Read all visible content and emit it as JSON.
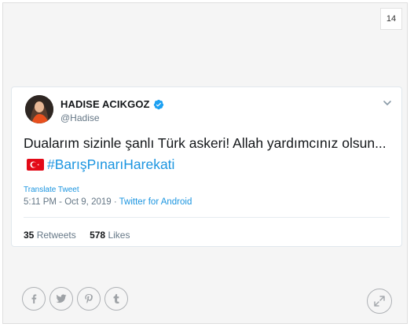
{
  "page_number": "14",
  "tweet": {
    "author_name": "HADISE ACIKGOZ",
    "handle": "@Hadise",
    "verified": true,
    "text_main": "Dualarım sizinle şanlı Türk askeri! Allah yardımcınız olsun...",
    "flag": "turkey-flag",
    "hashtag": "#BarışPınarıHarekati",
    "translate_label": "Translate Tweet",
    "timestamp": "5:11 PM - Oct 9, 2019",
    "separator": " · ",
    "source": "Twitter for Android",
    "retweets_count": "35",
    "retweets_label": "Retweets",
    "likes_count": "578",
    "likes_label": "Likes"
  },
  "share": {
    "icons": [
      "facebook-icon",
      "twitter-icon",
      "pinterest-icon",
      "tumblr-icon"
    ],
    "expand_icon": "expand-icon"
  },
  "colors": {
    "link": "#1b95e0",
    "verified": "#1da1f2",
    "card_bg": "#f5f5f5"
  }
}
